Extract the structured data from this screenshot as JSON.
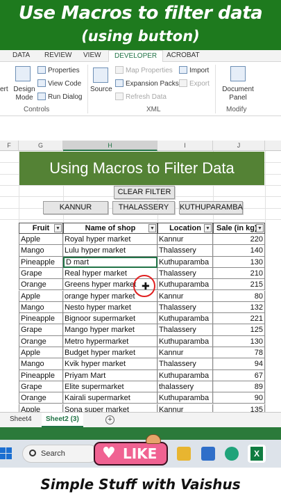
{
  "banner": {
    "line1": "Use Macros to filter data",
    "line2": "(using button)"
  },
  "ribbon": {
    "tabs": [
      "DATA",
      "REVIEW",
      "VIEW",
      "DEVELOPER",
      "ACROBAT"
    ],
    "active_tab": "DEVELOPER",
    "controls_group": {
      "label": "Controls",
      "insert_partial": "ert",
      "design_mode": "Design Mode",
      "properties": "Properties",
      "view_code": "View Code",
      "run_dialog": "Run Dialog"
    },
    "xml_group": {
      "label": "XML",
      "source": "Source",
      "map_properties": "Map Properties",
      "expansion_packs": "Expansion Packs",
      "refresh_data": "Refresh Data",
      "import": "Import",
      "export": "Export"
    },
    "modify_group": {
      "label": "Modify",
      "document_panel": "Document Panel"
    }
  },
  "columns": [
    "F",
    "G",
    "H",
    "I",
    "J"
  ],
  "selected_column": "H",
  "sheet": {
    "title": "Using Macros to Filter Data",
    "buttons": {
      "clear": "CLEAR FILTER",
      "kannur": "KANNUR",
      "thalassery": "THALASSERY",
      "kuthuparamba": "KUTHUPARAMBA"
    },
    "headers": [
      "Fruit",
      "Name of shop",
      "Location",
      "Sale (in kg)"
    ],
    "rows": [
      [
        "Apple",
        "Royal hyper market",
        "Kannur",
        "220"
      ],
      [
        "Mango",
        "Lulu hyper market",
        "Thalassery",
        "140"
      ],
      [
        "Pineapple",
        "D mart",
        "Kuthuparamba",
        "130"
      ],
      [
        "Grape",
        "Real hyper market",
        "Thalassery",
        "210"
      ],
      [
        "Orange",
        "Greens hyper market",
        "Kuthuparamba",
        "215"
      ],
      [
        "Apple",
        "orange hyper market",
        "Kannur",
        "80"
      ],
      [
        "Mango",
        "Nesto hyper market",
        "Thalassery",
        "132"
      ],
      [
        "Pineapple",
        "Bignoor supermarket",
        "Kuthuparamba",
        "221"
      ],
      [
        "Grape",
        "Mango hyper market",
        "Thalassery",
        "125"
      ],
      [
        "Orange",
        "Metro hypermarket",
        "Kuthuparamba",
        "130"
      ],
      [
        "Apple",
        "Budget hyper market",
        "Kannur",
        "78"
      ],
      [
        "Mango",
        "Kvik hyper market",
        "Thalassery",
        "94"
      ],
      [
        "Pineapple",
        "Priyam Mart",
        "Kuthuparamba",
        "67"
      ],
      [
        "Grape",
        "Elite supermarket",
        "thalassery",
        "89"
      ],
      [
        "Orange",
        "Kairali supermarket",
        "Kuthuparamba",
        "90"
      ],
      [
        "Apple",
        "Sona super market",
        "Kannur",
        "135"
      ]
    ]
  },
  "sheet_tabs": {
    "sheet4": "Sheet4",
    "sheet2": "Sheet2 (3)"
  },
  "taskbar": {
    "search": "Search",
    "like": "LIKE"
  },
  "footer": "Simple Stuff with Vaishus",
  "colors": {
    "banner": "#1e7a1e",
    "title_fill": "#548235",
    "excel_green": "#217346",
    "like_pink": "#f06292"
  }
}
